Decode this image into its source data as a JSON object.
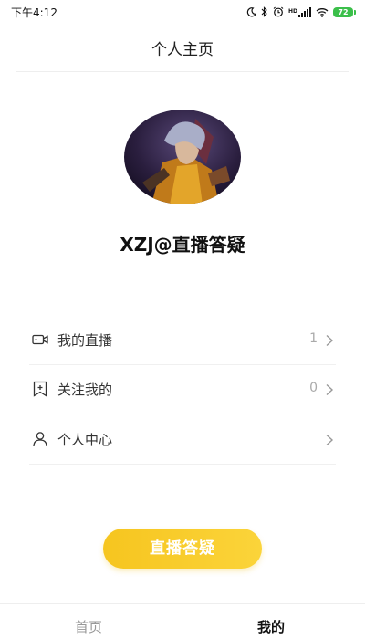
{
  "status_bar": {
    "time": "下午4:12",
    "battery_level": "72",
    "icons": [
      "moon-icon",
      "bluetooth-icon",
      "alarm-icon",
      "signal-icon",
      "wifi-icon",
      "battery-icon"
    ]
  },
  "header": {
    "title": "个人主页"
  },
  "profile": {
    "username": "XZJ@直播答疑"
  },
  "menu": {
    "items": [
      {
        "label": "我的直播",
        "count": "1",
        "icon": "video-camera-icon"
      },
      {
        "label": "关注我的",
        "count": "0",
        "icon": "bookmark-plus-icon"
      },
      {
        "label": "个人中心",
        "count": "",
        "icon": "person-icon"
      }
    ]
  },
  "action": {
    "label": "直播答疑"
  },
  "bottom_nav": {
    "tabs": [
      {
        "label": "首页",
        "active": false
      },
      {
        "label": "我的",
        "active": true
      }
    ]
  },
  "colors": {
    "accent": "#F8C92A",
    "text": "#222222",
    "muted": "#999999",
    "divider": "#EEEEEE"
  }
}
